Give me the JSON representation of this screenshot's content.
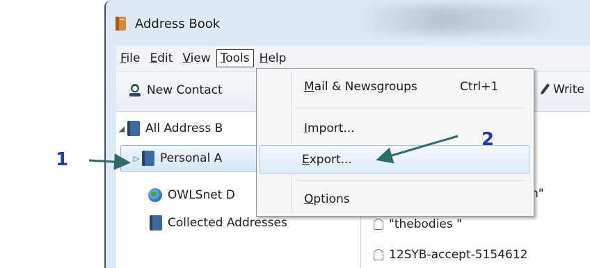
{
  "window": {
    "title": "Address Book"
  },
  "menubar": {
    "items": [
      {
        "label": "File",
        "ul": "F",
        "rest": "ile"
      },
      {
        "label": "Edit",
        "ul": "E",
        "rest": "dit"
      },
      {
        "label": "View",
        "ul": "V",
        "rest": "iew"
      },
      {
        "label": "Tools",
        "ul": "T",
        "rest": "ools"
      },
      {
        "label": "Help",
        "ul": "H",
        "rest": "elp"
      }
    ]
  },
  "toolbar": {
    "new_contact": "New Contact",
    "write": "Write"
  },
  "tree": {
    "all": "All Address B",
    "personal": "Personal A",
    "owlsnet": "OWLSnet D",
    "collected": "Collected Addresses"
  },
  "contacts": {
    "partial": "n\"",
    "item1": "\"thebodies \"",
    "item2": "12SYB-accept-5154612"
  },
  "tools_menu": {
    "mail_ul": "M",
    "mail_rest": "ail & Newsgroups",
    "mail_shortcut": "Ctrl+1",
    "import_ul": "I",
    "import_rest": "mport...",
    "export_ul": "E",
    "export_rest": "xport...",
    "options_ul": "O",
    "options_rest": "ptions"
  },
  "annotations": {
    "step1": "1",
    "step2": "2"
  },
  "colors": {
    "annotation": "#1f3fa3",
    "arrow": "#2e6b6b"
  }
}
